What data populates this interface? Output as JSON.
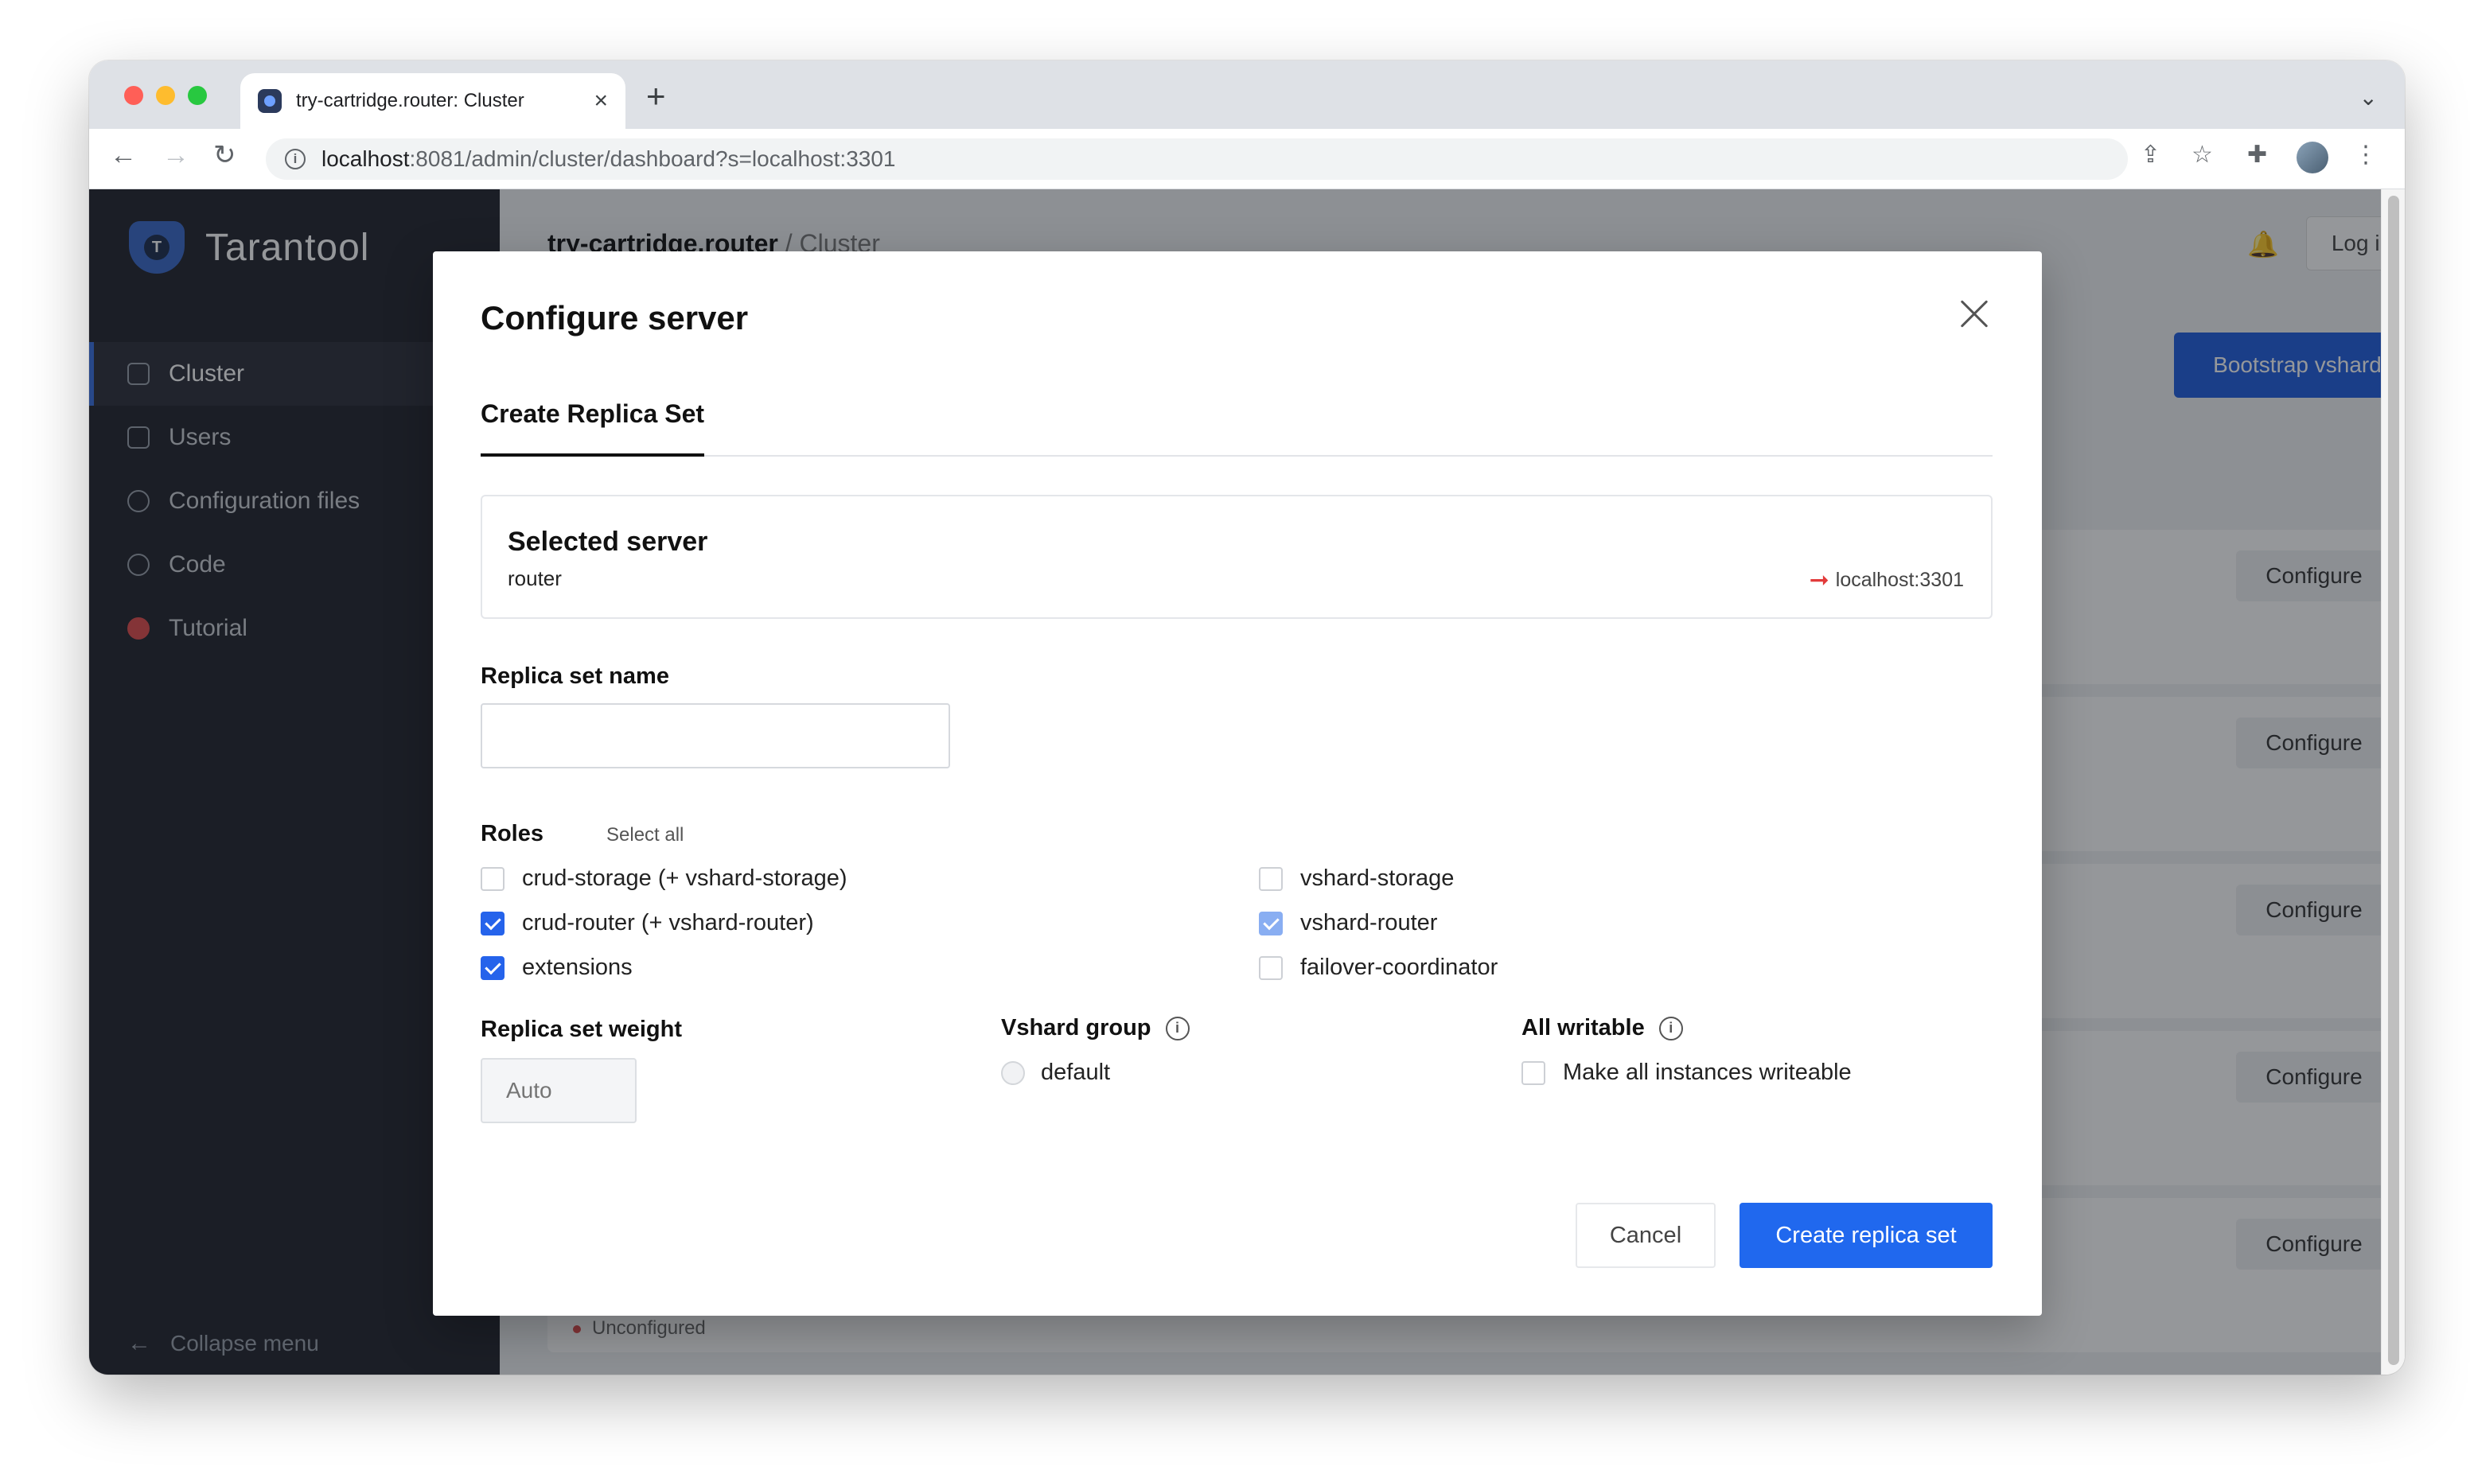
{
  "browser": {
    "tab_title": "try-cartridge.router: Cluster",
    "new_tab": "+",
    "url_host": "localhost",
    "url_rest": ":8081/admin/cluster/dashboard?s=localhost:3301"
  },
  "sidebar": {
    "brand": "Tarantool",
    "items": [
      {
        "label": "Cluster",
        "icon": "cluster-icon",
        "active": true
      },
      {
        "label": "Users",
        "icon": "users-icon",
        "active": false
      },
      {
        "label": "Configuration files",
        "icon": "gear-icon",
        "active": false
      },
      {
        "label": "Code",
        "icon": "code-icon",
        "active": false
      },
      {
        "label": "Tutorial",
        "icon": "tutorial-icon",
        "active": false
      }
    ],
    "collapse_label": "Collapse menu"
  },
  "header": {
    "app": "try-cartridge.router",
    "separator": "/",
    "page": "Cluster",
    "login": "Log in"
  },
  "background": {
    "bootstrap_label": "Bootstrap vshard",
    "configure_label": "Configure",
    "status_label": "Unconfigured"
  },
  "modal": {
    "title": "Configure server",
    "tab": "Create Replica Set",
    "selected_server": {
      "heading": "Selected server",
      "alias": "router",
      "uri": "localhost:3301"
    },
    "replica_set_name": {
      "label": "Replica set name",
      "value": ""
    },
    "roles": {
      "label": "Roles",
      "select_all": "Select all",
      "items": [
        {
          "label": "crud-storage (+ vshard-storage)",
          "checked": false
        },
        {
          "label": "crud-router (+ vshard-router)",
          "checked": true
        },
        {
          "label": "extensions",
          "checked": true
        },
        {
          "label": "vshard-storage",
          "checked": false
        },
        {
          "label": "vshard-router",
          "checked": true,
          "dependent": true
        },
        {
          "label": "failover-coordinator",
          "checked": false
        }
      ]
    },
    "weight": {
      "label": "Replica set weight",
      "placeholder": "Auto"
    },
    "vshard_group": {
      "label": "Vshard group",
      "option": "default"
    },
    "all_writable": {
      "label": "All writable",
      "option": "Make all instances writeable"
    },
    "cancel": "Cancel",
    "create": "Create replica set"
  },
  "colors": {
    "accent": "#2068ee",
    "sidebar_bg": "#21232c",
    "uri_arrow": "#e23b3b"
  }
}
